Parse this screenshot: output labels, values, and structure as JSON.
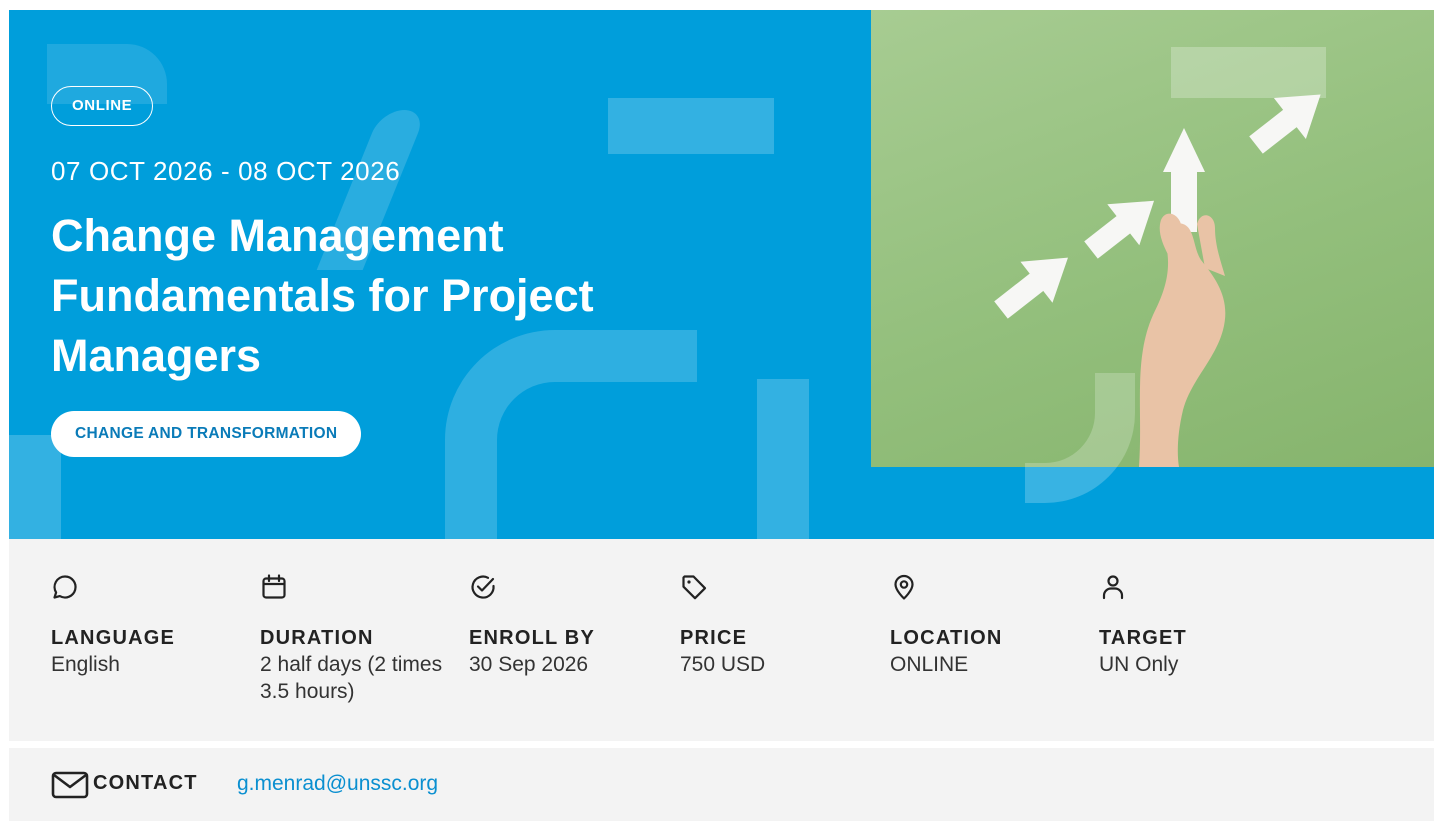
{
  "hero": {
    "badge": "ONLINE",
    "dates": "07 OCT 2026 - 08 OCT 2026",
    "title": "Change Management Fundamentals for Project Managers",
    "tag": "CHANGE AND TRANSFORMATION",
    "background_color": "#009edb"
  },
  "info": {
    "items": [
      {
        "icon": "chat-bubble-icon",
        "label": "LANGUAGE",
        "value": "English"
      },
      {
        "icon": "calendar-icon",
        "label": "DURATION",
        "value": "2 half days (2 times 3.5 hours)"
      },
      {
        "icon": "check-circle-icon",
        "label": "ENROLL BY",
        "value": "30 Sep 2026"
      },
      {
        "icon": "price-tag-icon",
        "label": "PRICE",
        "value": "750 USD"
      },
      {
        "icon": "location-pin-icon",
        "label": "LOCATION",
        "value": "ONLINE"
      },
      {
        "icon": "user-icon",
        "label": "TARGET",
        "value": "UN Only"
      }
    ]
  },
  "contact": {
    "icon": "mail-icon",
    "label": "CONTACT",
    "email": "g.menrad@unssc.org"
  },
  "colors": {
    "accent": "#009edb",
    "link": "#0a8fd0",
    "panel": "#f3f3f3"
  }
}
